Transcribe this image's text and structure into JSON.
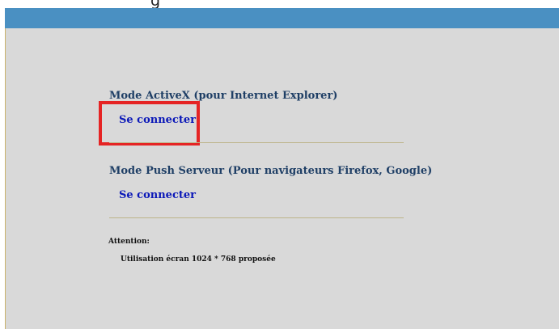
{
  "header": {
    "caption_fragment": "g"
  },
  "activex": {
    "title": "Mode ActiveX (pour Internet Explorer)",
    "connect_label": "Se connecter"
  },
  "pushserver": {
    "title": "Mode Push Serveur (Pour navigateurs Firefox, Google)",
    "connect_label": "Se connecter"
  },
  "attention": {
    "label": "Attention:",
    "message": "Utilisation écran 1024 * 768 proposée"
  },
  "colors": {
    "top_bar": "#4a90c2",
    "panel_bg": "#d9d9d9",
    "section_title": "#1f3f66",
    "link": "#0b18b8",
    "highlight": "#e52424",
    "divider": "#bdb48a"
  }
}
